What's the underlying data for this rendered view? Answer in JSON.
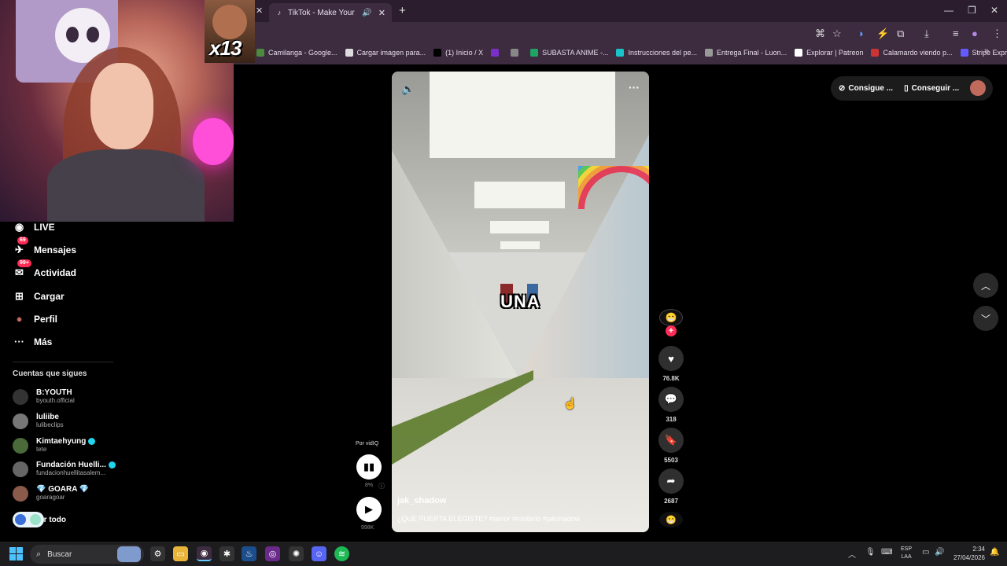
{
  "browser": {
    "active_tab_title": "TikTok - Make Your Day",
    "bookmarks": [
      {
        "label": "Camilanga - Google...",
        "color": "#4b8b3b"
      },
      {
        "label": "Cargar imagen para...",
        "color": "#ddd"
      },
      {
        "label": "(1) Inicio / X",
        "color": "#000"
      },
      {
        "label": "",
        "color": "#7b2fc9"
      },
      {
        "label": "",
        "color": "#888"
      },
      {
        "label": "SUBASTA ANIME -...",
        "color": "#1fa463"
      },
      {
        "label": "Instrucciones del pe...",
        "color": "#19c3c9"
      },
      {
        "label": "Entrega Final - Luon...",
        "color": "#999"
      },
      {
        "label": "Explorar | Patreon",
        "color": "#fff"
      },
      {
        "label": "Calamardo viendo p...",
        "color": "#c33"
      },
      {
        "label": "Stripe Express",
        "color": "#635bff"
      }
    ]
  },
  "overlay": {
    "badge_text": "x13"
  },
  "sidebar": {
    "nav": [
      {
        "label": "LIVE",
        "icon": "live-icon",
        "badge": ""
      },
      {
        "label": "Mensajes",
        "icon": "messages-icon",
        "badge": "69"
      },
      {
        "label": "Actividad",
        "icon": "activity-icon",
        "badge": "99+"
      },
      {
        "label": "Cargar",
        "icon": "upload-icon",
        "badge": ""
      },
      {
        "label": "Perfil",
        "icon": "profile-icon",
        "badge": ""
      },
      {
        "label": "Más",
        "icon": "more-icon",
        "badge": ""
      }
    ],
    "following_title": "Cuentas que sigues",
    "accounts": [
      {
        "name": "B:YOUTH",
        "handle": "byouth.official",
        "verified": false,
        "color": "#333"
      },
      {
        "name": "luliibe",
        "handle": "lulibeclips",
        "verified": false,
        "color": "#777"
      },
      {
        "name": "Kimtaehyung",
        "handle": "tete",
        "verified": true,
        "color": "#4a6a3a"
      },
      {
        "name": "Fundación Huelli...",
        "handle": "fundacionhuellitasalem...",
        "verified": true,
        "color": "#666"
      },
      {
        "name": "💎 GOARA 💎",
        "handle": "goaragoar",
        "verified": false,
        "color": "#8a5a4a"
      }
    ],
    "see_all": "Ver todo"
  },
  "video": {
    "overlay_word": "UNA",
    "author": "jak_shadow",
    "caption": "¿QUE PUERTA ELEGISTE? #terror #misterio #jakshadow"
  },
  "vidiq": {
    "label": "Por vidIQ",
    "percent": "8%",
    "views": "998K"
  },
  "actions": {
    "likes": "76.8K",
    "comments": "318",
    "saves": "5503",
    "shares": "2687"
  },
  "top_right": {
    "coins_label": "Consigue ...",
    "app_label": "Conseguir ..."
  },
  "taskbar": {
    "search_placeholder": "Buscar",
    "lang_1": "ESP",
    "lang_2": "LAA",
    "time": "2:34",
    "date": "27/04/2026"
  },
  "colors": {
    "accent": "#fe2c55",
    "verified": "#20d5ec",
    "tab_bg": "#2b1d2e"
  }
}
